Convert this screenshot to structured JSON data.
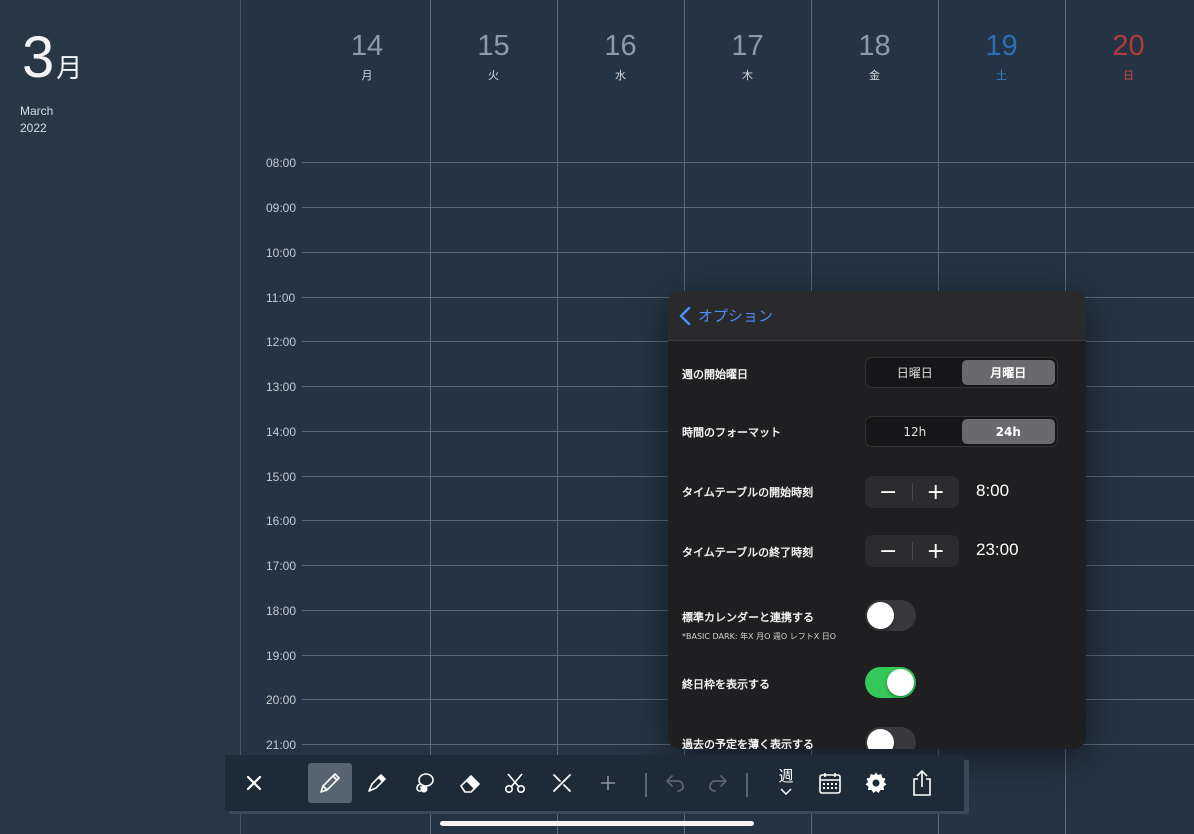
{
  "month": {
    "number": "3",
    "suffix": "月",
    "english": "March",
    "year": "2022"
  },
  "days": [
    {
      "num": "14",
      "weekday": "月",
      "color": "#8e9aa8",
      "wd_color": "#d5dbe2"
    },
    {
      "num": "15",
      "weekday": "火",
      "color": "#8e9aa8",
      "wd_color": "#d5dbe2"
    },
    {
      "num": "16",
      "weekday": "水",
      "color": "#8e9aa8",
      "wd_color": "#d5dbe2"
    },
    {
      "num": "17",
      "weekday": "木",
      "color": "#8e9aa8",
      "wd_color": "#d5dbe2"
    },
    {
      "num": "18",
      "weekday": "金",
      "color": "#8e9aa8",
      "wd_color": "#d5dbe2"
    },
    {
      "num": "19",
      "weekday": "土",
      "color": "#2c6fb4",
      "wd_color": "#3a86d6"
    },
    {
      "num": "20",
      "weekday": "日",
      "color": "#b23a3a",
      "wd_color": "#d84545"
    }
  ],
  "times": [
    "08:00",
    "09:00",
    "10:00",
    "11:00",
    "12:00",
    "13:00",
    "14:00",
    "15:00",
    "16:00",
    "17:00",
    "18:00",
    "19:00",
    "20:00",
    "21:00"
  ],
  "options": {
    "title": "オプション",
    "week_start": {
      "label": "週の開始曜日",
      "options": [
        "日曜日",
        "月曜日"
      ],
      "selected": "月曜日"
    },
    "time_format": {
      "label": "時間のフォーマット",
      "options": [
        "12h",
        "24h"
      ],
      "selected": "24h"
    },
    "timetable_start": {
      "label": "タイムテーブルの開始時刻",
      "value": "8:00"
    },
    "timetable_end": {
      "label": "タイムテーブルの終了時刻",
      "value": "23:00"
    },
    "sync_calendar": {
      "label": "標準カレンダーと連携する",
      "note": "*BASIC DARK: 年X 月O 週O レフトX 日O",
      "on": false
    },
    "all_day_frame": {
      "label": "終日枠を表示する",
      "on": true
    },
    "fade_past": {
      "label": "過去の予定を薄く表示する",
      "on": false
    }
  },
  "toolbar": {
    "icons": [
      "close-icon",
      "pencil-icon",
      "marker-icon",
      "lasso-icon",
      "eraser-icon",
      "scissors-icon",
      "magic-wand-icon",
      "add-icon",
      "undo-icon",
      "redo-icon",
      "view-mode",
      "calendar-icon",
      "gear-icon",
      "share-icon"
    ],
    "view_label": "週"
  },
  "colors": {
    "background": "#253444",
    "accent": "#4a8ff5",
    "toggle_on": "#34c759"
  }
}
